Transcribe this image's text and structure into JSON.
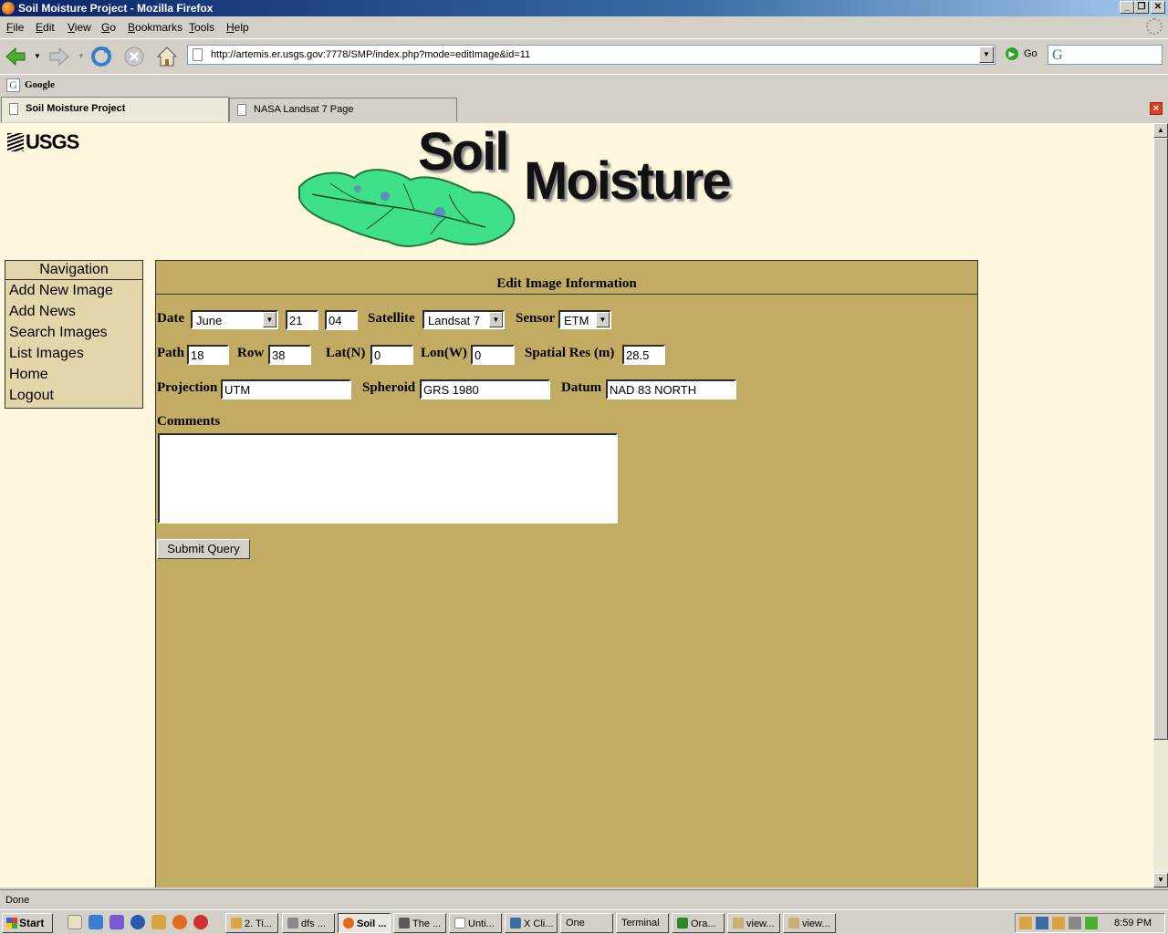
{
  "window": {
    "title": "Soil Moisture Project - Mozilla Firefox",
    "min": "_",
    "max": "❐",
    "close": "✕"
  },
  "menu": [
    {
      "pre": "",
      "key": "F",
      "rest": "ile"
    },
    {
      "pre": "",
      "key": "E",
      "rest": "dit"
    },
    {
      "pre": "",
      "key": "V",
      "rest": "iew"
    },
    {
      "pre": "",
      "key": "G",
      "rest": "o"
    },
    {
      "pre": "",
      "key": "B",
      "rest": "ookmarks"
    },
    {
      "pre": "",
      "key": "T",
      "rest": "ools"
    },
    {
      "pre": "",
      "key": "H",
      "rest": "elp"
    }
  ],
  "nav": {
    "url": "http://artemis.er.usgs.gov:7778/SMP/index.php?mode=editImage&id=11",
    "go_label": "Go",
    "search_glyph": "G"
  },
  "bookmarks": {
    "items": [
      {
        "label": "Google",
        "icon": "G"
      }
    ]
  },
  "tabs": [
    {
      "label": "Soil Moisture Project",
      "active": true
    },
    {
      "label": "NASA Landsat 7 Page",
      "active": false
    }
  ],
  "page": {
    "logo_text": "USGS",
    "banner": {
      "word1": "Soil",
      "word2": "Moisture"
    },
    "navigation": {
      "title": "Navigation",
      "items": [
        "Add New Image",
        "Add News",
        "Search Images",
        "List Images",
        "Home",
        "Logout"
      ]
    },
    "form": {
      "heading": "Edit Image Information",
      "date_label": "Date",
      "month": "June",
      "day": "21",
      "year": "04",
      "satellite_label": "Satellite",
      "satellite": "Landsat 7",
      "sensor_label": "Sensor",
      "sensor": "ETM",
      "path_label": "Path",
      "path": "18",
      "row_label": "Row",
      "row": "38",
      "lat_label": "Lat(N)",
      "lat": "0",
      "lon_label": "Lon(W)",
      "lon": "0",
      "spatial_label": "Spatial Res (m)",
      "spatial": "28.5",
      "projection_label": "Projection",
      "projection": "UTM",
      "spheroid_label": "Spheroid",
      "spheroid": "GRS 1980",
      "datum_label": "Datum",
      "datum": "NAD 83 NORTH",
      "comments_label": "Comments",
      "comments": "",
      "submit_label": "Submit Query"
    }
  },
  "status": {
    "text": "Done"
  },
  "taskbar": {
    "start_label": "Start",
    "buttons": [
      {
        "label": "2. Ti...",
        "active": false,
        "color": "#d9a441"
      },
      {
        "label": "dfs ...",
        "active": false,
        "color": "#8a8a8a"
      },
      {
        "label": "Soil ...",
        "active": true,
        "color": "#e06b1f"
      },
      {
        "label": "The ...",
        "active": false,
        "color": "#5a5a5a"
      },
      {
        "label": "Unti...",
        "active": false,
        "color": "#ffffff"
      },
      {
        "label": "X Cli...",
        "active": false,
        "color": "#3a6ea5"
      },
      {
        "label": "One",
        "active": false,
        "color": ""
      },
      {
        "label": "Terminal",
        "active": false,
        "color": ""
      },
      {
        "label": "Ora...",
        "active": false,
        "color": "#2a8a2a"
      },
      {
        "label": "view...",
        "active": false,
        "color": "#c8b070"
      },
      {
        "label": "view...",
        "active": false,
        "color": "#c8b070"
      }
    ],
    "clock": "8:59 PM"
  }
}
